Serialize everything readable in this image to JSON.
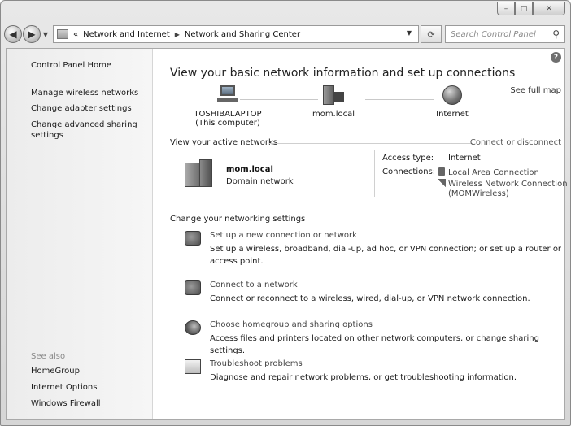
{
  "window": {
    "caption": {
      "minimize": "–",
      "maximize": "□",
      "close": "✕"
    }
  },
  "navbar": {
    "back": "◀",
    "forward": "▶",
    "breadcrumb_prefix": "«",
    "breadcrumb": [
      "Network and Internet",
      "Network and Sharing Center"
    ],
    "breadcrumb_sep": "▶",
    "search_placeholder": "Search Control Panel"
  },
  "left_pane": {
    "home": "Control Panel Home",
    "links": [
      "Manage wireless networks",
      "Change adapter settings",
      "Change advanced sharing",
      "settings"
    ],
    "see_also": "See also",
    "see_also_links": [
      "HomeGroup",
      "Internet Options",
      "Windows Firewall"
    ]
  },
  "main": {
    "help": "?",
    "title": "View your basic network information and set up connections",
    "see_full_map": "See full map",
    "map": {
      "computer_name": "TOSHIBALAPTOP",
      "computer_sub": "(This computer)",
      "network": "mom.local",
      "internet": "Internet"
    },
    "active_networks_head": "View your active networks",
    "connect_disconnect": "Connect or disconnect",
    "active": {
      "name": "mom.local",
      "type": "Domain network",
      "access_type_label": "Access type:",
      "access_type_value": "Internet",
      "connections_label": "Connections:",
      "connection_1": "Local Area Connection",
      "connection_2": "Wireless Network Connection",
      "connection_2b": "(MOMWireless)"
    },
    "change_settings_head": "Change your networking settings",
    "tasks": [
      {
        "link": "Set up a new connection or network",
        "desc": "Set up a wireless, broadband, dial-up, ad hoc, or VPN connection; or set up a router or access point."
      },
      {
        "link": "Connect to a network",
        "desc": "Connect or reconnect to a wireless, wired, dial-up, or VPN network connection."
      },
      {
        "link": "Choose homegroup and sharing options",
        "desc": "Access files and printers located on other network computers, or change sharing settings."
      },
      {
        "link": "Troubleshoot problems",
        "desc": "Diagnose and repair network problems, or get troubleshooting information."
      }
    ]
  }
}
